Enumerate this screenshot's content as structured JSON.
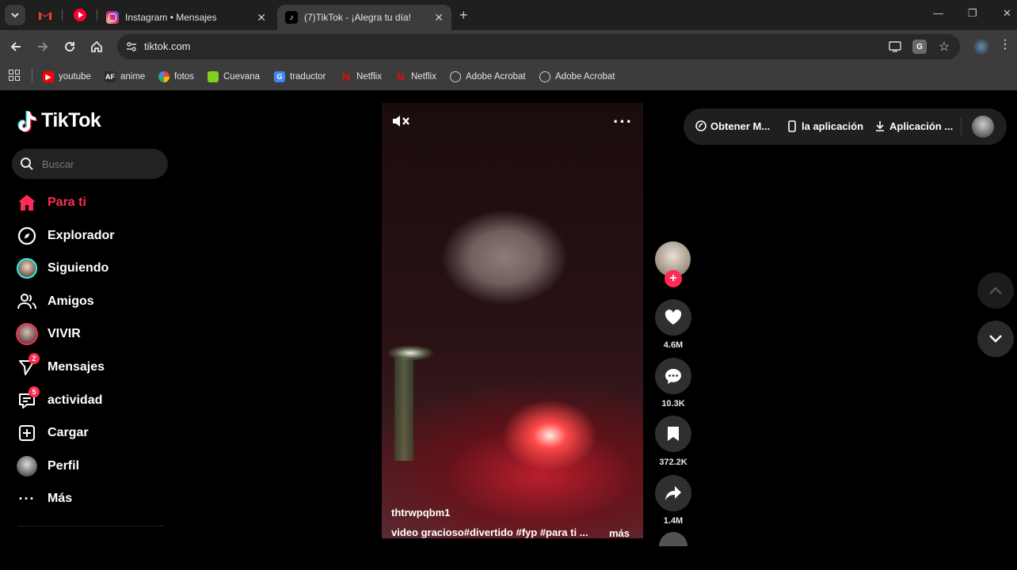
{
  "browser": {
    "tabs": [
      {
        "title": "Instagram • Mensajes",
        "active": false
      },
      {
        "title": "(7)TikTok - ¡Alegra tu día!",
        "active": true
      }
    ],
    "url": "tiktok.com",
    "bookmarks": [
      {
        "label": "youtube",
        "icon": "youtube-icon",
        "color": "#ff0000"
      },
      {
        "label": "anime",
        "icon": "anime-icon",
        "color": "#2b2b2b"
      },
      {
        "label": "fotos",
        "icon": "google-photos-icon",
        "color": "#fbbc05"
      },
      {
        "label": "Cuevana",
        "icon": "cuevana-icon",
        "color": "#7ed321"
      },
      {
        "label": "traductor",
        "icon": "translate-icon",
        "color": "#4285f4"
      },
      {
        "label": "Netflix",
        "icon": "netflix-icon",
        "color": "#e50914"
      },
      {
        "label": "Netflix",
        "icon": "netflix-icon",
        "color": "#e50914"
      },
      {
        "label": "Adobe Acrobat",
        "icon": "globe-icon",
        "color": "#cccccc"
      },
      {
        "label": "Adobe Acrobat",
        "icon": "globe-icon",
        "color": "#cccccc"
      }
    ]
  },
  "tiktok": {
    "logo": "TikTok",
    "search_placeholder": "Buscar",
    "nav": [
      {
        "label": "Para ti",
        "icon": "home-icon",
        "active": true
      },
      {
        "label": "Explorador",
        "icon": "compass-icon"
      },
      {
        "label": "Siguiendo",
        "icon": "following-avatar-icon"
      },
      {
        "label": "Amigos",
        "icon": "friends-icon"
      },
      {
        "label": "VIVIR",
        "icon": "live-avatar-icon"
      },
      {
        "label": "Mensajes",
        "icon": "messages-icon",
        "badge": "2"
      },
      {
        "label": "actividad",
        "icon": "activity-icon",
        "badge": "5"
      },
      {
        "label": "Cargar",
        "icon": "upload-icon"
      },
      {
        "label": "Perfil",
        "icon": "profile-avatar-icon"
      },
      {
        "label": "Más",
        "icon": "more-icon"
      }
    ],
    "topbar": {
      "coins": "Obtener M...",
      "app": "la aplicación",
      "download": "Aplicación ..."
    },
    "video": {
      "author": "thtrwpqbm1",
      "caption": "video gracioso#divertido #fyp #para ti ...",
      "more": "más"
    },
    "actions": {
      "likes": "4.6M",
      "comments": "10.3K",
      "saves": "372.2K",
      "shares": "1.4M"
    },
    "accent_color": "#fe2c55"
  }
}
